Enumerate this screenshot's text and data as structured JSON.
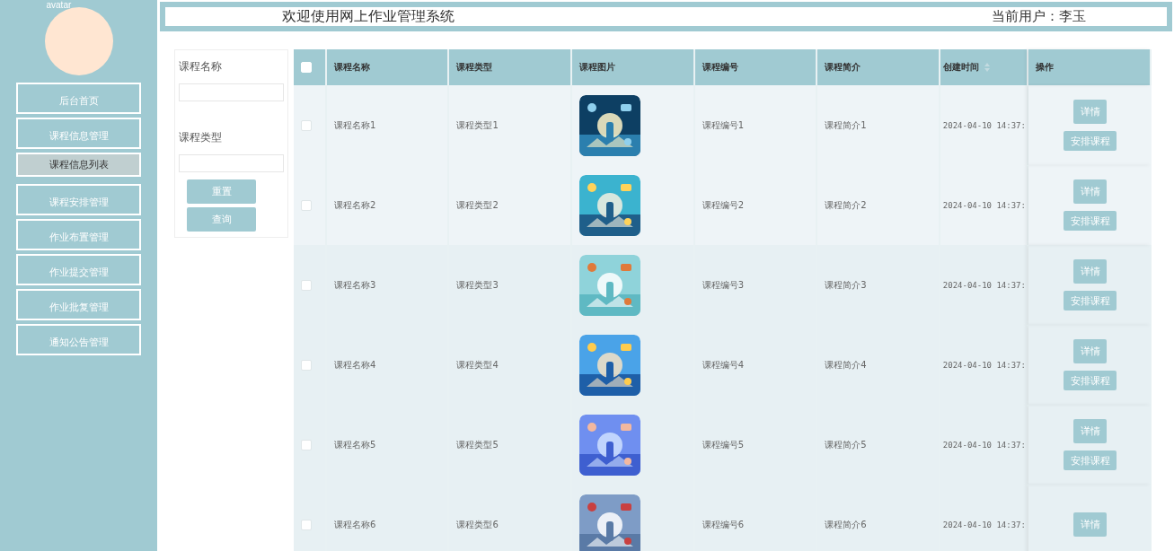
{
  "sidebar": {
    "avatar_alt": "avatar",
    "items": [
      {
        "label": "后台首页",
        "kind": "menu",
        "selected": false
      },
      {
        "label": "课程信息管理",
        "kind": "menu",
        "selected": false
      },
      {
        "label": "课程信息列表",
        "kind": "sub",
        "selected": true
      },
      {
        "label": "课程安排管理",
        "kind": "menu",
        "selected": false
      },
      {
        "label": "作业布置管理",
        "kind": "menu",
        "selected": false
      },
      {
        "label": "作业提交管理",
        "kind": "menu",
        "selected": false
      },
      {
        "label": "作业批复管理",
        "kind": "menu",
        "selected": false
      },
      {
        "label": "通知公告管理",
        "kind": "menu",
        "selected": false
      }
    ]
  },
  "header": {
    "title": "欢迎使用网上作业管理系统",
    "user": "当前用户：李玉"
  },
  "search": {
    "fields": [
      {
        "label": "课程名称"
      },
      {
        "label": "课程类型"
      }
    ],
    "buttons": [
      "重置",
      "查询"
    ]
  },
  "table": {
    "all_checked": false,
    "columns": [
      {
        "label": "课程名称"
      },
      {
        "label": "课程类型"
      },
      {
        "label": "课程图片"
      },
      {
        "label": "课程编号"
      },
      {
        "label": "课程简介"
      },
      {
        "label": "创建时间",
        "sortable": true
      },
      {
        "label": "操作"
      }
    ],
    "rows": [
      {
        "checked": false,
        "name": "课程名称1",
        "type": "课程类型1",
        "code": "课程编号1",
        "intro": "课程简介1",
        "created": "2024-04-10 14:37:",
        "actions": [
          "详情",
          "安排课程"
        ]
      },
      {
        "checked": false,
        "name": "课程名称2",
        "type": "课程类型2",
        "code": "课程编号2",
        "intro": "课程简介2",
        "created": "2024-04-10 14:37:",
        "actions": [
          "详情",
          "安排课程"
        ]
      },
      {
        "checked": false,
        "name": "课程名称3",
        "type": "课程类型3",
        "code": "课程编号3",
        "intro": "课程简介3",
        "created": "2024-04-10 14:37:",
        "actions": [
          "详情",
          "安排课程"
        ]
      },
      {
        "checked": false,
        "name": "课程名称4",
        "type": "课程类型4",
        "code": "课程编号4",
        "intro": "课程简介4",
        "created": "2024-04-10 14:37:",
        "actions": [
          "详情",
          "安排课程"
        ]
      },
      {
        "checked": false,
        "name": "课程名称5",
        "type": "课程类型5",
        "code": "课程编号5",
        "intro": "课程简介5",
        "created": "2024-04-10 14:37:",
        "actions": [
          "详情",
          "安排课程"
        ]
      },
      {
        "checked": false,
        "name": "课程名称6",
        "type": "课程类型6",
        "code": "课程编号6",
        "intro": "课程简介6",
        "created": "2024-04-10 14:37:",
        "actions": [
          "详情"
        ]
      }
    ]
  }
}
